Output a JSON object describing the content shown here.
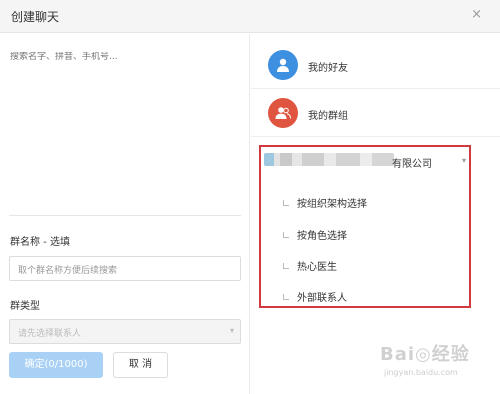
{
  "dialog": {
    "title": "创建聊天",
    "close_icon": "×"
  },
  "left": {
    "search_placeholder": "搜索名字、拼音、手机号...",
    "group_name_label": "群名称 - 选填",
    "group_name_placeholder": "取个群名称方便后续搜索",
    "group_type_label": "群类型",
    "group_type_placeholder": "请先选择联系人",
    "confirm_label": "确定(0/1000)",
    "cancel_label": "取 消"
  },
  "right": {
    "rows": [
      {
        "label": "我的好友",
        "icon": "user-icon",
        "color": "#3d8fe0"
      },
      {
        "label": "我的群组",
        "icon": "group-icon",
        "color": "#e0553f"
      }
    ],
    "org_name_suffix": "有限公司",
    "sub_items": [
      "按组织架构选择",
      "按角色选择",
      "热心医生",
      "外部联系人"
    ]
  },
  "watermark": {
    "text": "Bai◎经验",
    "url": "jingyan.baidu.com"
  },
  "colors": {
    "highlight_border": "#d2393e",
    "primary_button": "#a9d1f6"
  }
}
